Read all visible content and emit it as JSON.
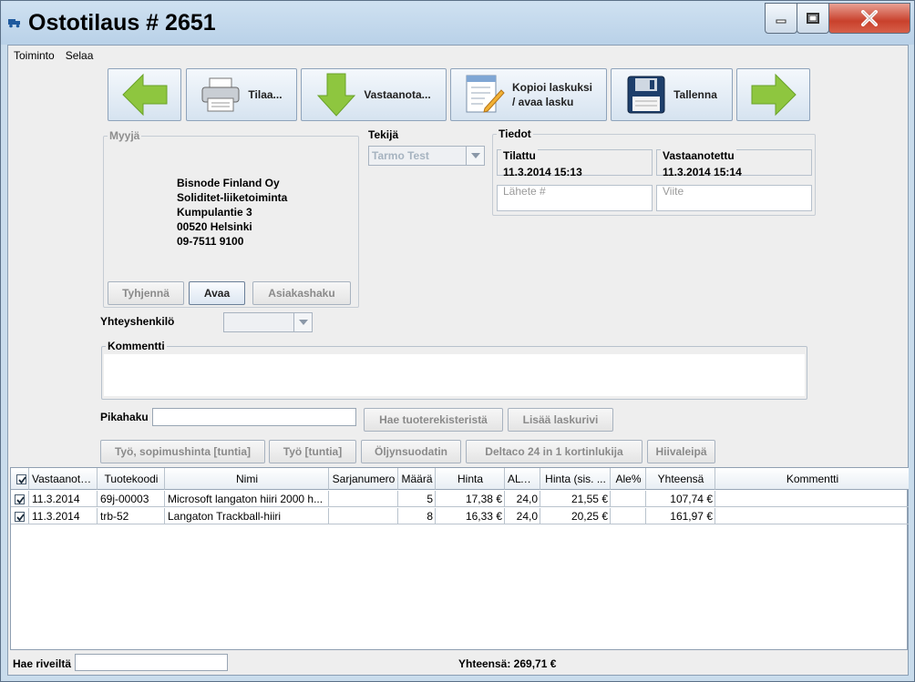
{
  "window": {
    "title": "Ostotilaus # 2651"
  },
  "menu": [
    "Toiminto",
    "Selaa"
  ],
  "toolbar": {
    "order_label": "Tilaa...",
    "receive_label": "Vastaanota...",
    "copy_invoice_line1": "Kopioi laskuksi",
    "copy_invoice_line2": "/ avaa lasku",
    "save_label": "Tallenna"
  },
  "seller": {
    "title": "Myyjä",
    "lines": [
      "Bisnode Finland Oy",
      "Soliditet-liiketoiminta",
      "Kumpulantie 3",
      "00520 Helsinki",
      "09-7511 9100"
    ],
    "clear_label": "Tyhjennä",
    "open_label": "Avaa",
    "customer_search_label": "Asiakashaku"
  },
  "maker": {
    "label": "Tekijä",
    "value": "Tarmo Test"
  },
  "info": {
    "title": "Tiedot",
    "ordered_label": "Tilattu",
    "ordered_value": "11.3.2014 15:13",
    "received_label": "Vastaanotettu",
    "received_value": "11.3.2014 15:14",
    "shipment_label": "Lähete #",
    "reference_label": "Viite"
  },
  "contact": {
    "label": "Yhteyshenkilö"
  },
  "comment": {
    "label": "Kommentti"
  },
  "quick_search": {
    "label": "Pikahaku",
    "search_registry_label": "Hae tuoterekisteristä",
    "add_row_label": "Lisää laskurivi"
  },
  "quick_products": [
    "Työ, sopimushinta [tuntia]",
    "Työ [tuntia]",
    "Öljynsuodatin",
    "Deltaco 24 in 1 kortinlukija",
    "Hiivaleipä"
  ],
  "table": {
    "columns": [
      "Vastaanote...",
      "Tuotekoodi",
      "Nimi",
      "Sarjanumero",
      "Määrä",
      "Hinta",
      "ALV-%",
      "Hinta (sis. ...",
      "Ale%",
      "Yhteensä",
      "Kommentti"
    ],
    "rows": [
      {
        "received": "11.3.2014",
        "code": "69j-00003",
        "name": "Microsoft langaton hiiri 2000 h...",
        "serial": "",
        "qty": "5",
        "price": "17,38 €",
        "vat": "24,0",
        "price_incl": "21,55 €",
        "discount": "",
        "total": "107,74 €",
        "comment": ""
      },
      {
        "received": "11.3.2014",
        "code": "trb-52",
        "name": "Langaton Trackball-hiiri",
        "serial": "",
        "qty": "8",
        "price": "16,33 €",
        "vat": "24,0",
        "price_incl": "20,25 €",
        "discount": "",
        "total": "161,97 €",
        "comment": ""
      }
    ]
  },
  "footer": {
    "filter_label": "Hae riveiltä",
    "total_text": "Yhteensä: 269,71 €"
  },
  "colors": {
    "accent": "#8ec63f",
    "window_frame": "#c9dcec",
    "close_button": "#c9412c"
  }
}
